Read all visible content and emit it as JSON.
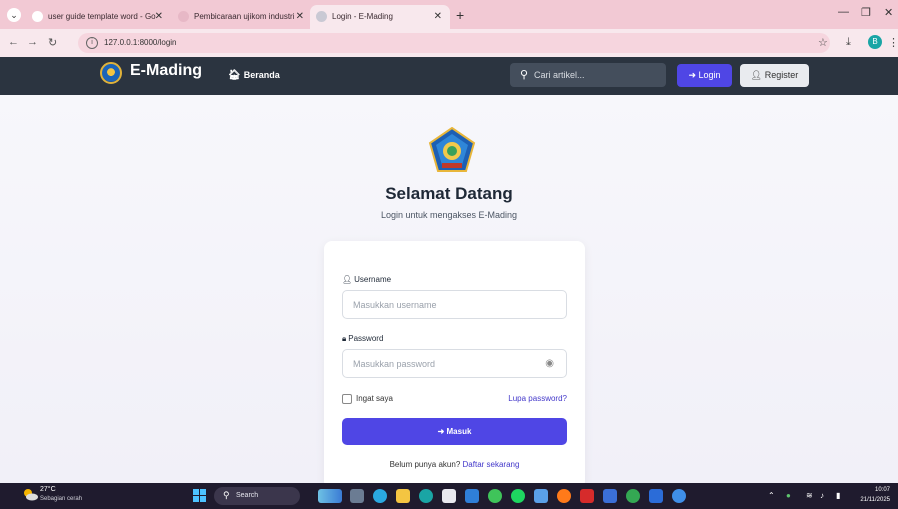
{
  "browser": {
    "tabs": [
      {
        "title": "user guide template word - Go",
        "active": false
      },
      {
        "title": "Pembicaraan ujikom industri",
        "active": false
      },
      {
        "title": "Login - E-Mading",
        "active": true
      }
    ],
    "url": "127.0.0.1:8000/login",
    "profile_initial": "B"
  },
  "navbar": {
    "brand": "E-Mading",
    "home_label": "Beranda",
    "search_placeholder": "Cari artikel...",
    "login_label": "Login",
    "register_label": "Register"
  },
  "login": {
    "title": "Selamat Datang",
    "subtitle": "Login untuk mengakses E-Mading",
    "username_label": "Username",
    "username_placeholder": "Masukkan username",
    "password_label": "Password",
    "password_placeholder": "Masukkan password",
    "remember_label": "Ingat saya",
    "forgot_label": "Lupa password?",
    "submit_label": "Masuk",
    "no_account_text": "Belum punya akun?",
    "register_link": "Daftar sekarang"
  },
  "taskbar": {
    "temperature": "27°C",
    "weather": "Sebagian cerah",
    "search_label": "Search",
    "time": "10:07",
    "date": "21/11/2025"
  },
  "colors": {
    "accent": "#4f46e5",
    "navbar": "#2b3440",
    "tabstrip": "#f2c9d4"
  }
}
